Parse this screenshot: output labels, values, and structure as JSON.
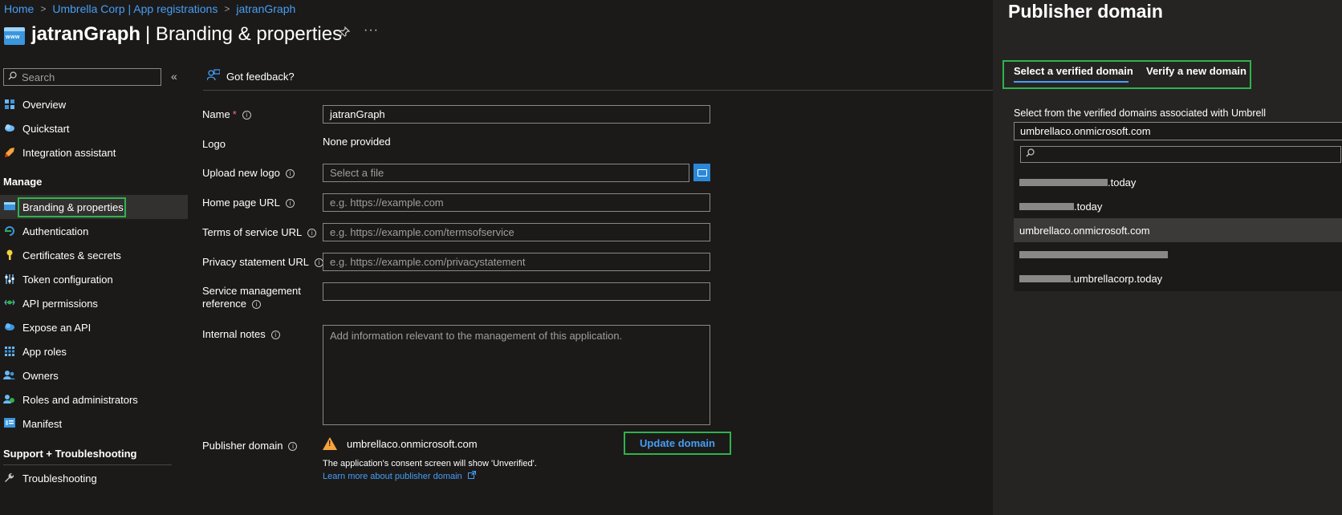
{
  "breadcrumb": {
    "items": [
      "Home",
      "Umbrella Corp | App registrations",
      "jatranGraph"
    ],
    "separator": ">"
  },
  "header": {
    "app_name": "jatranGraph",
    "page_suffix": "| Branding & properties",
    "more_label": "···"
  },
  "sidebar": {
    "search_placeholder": "Search",
    "collapse_label": "«",
    "items": [
      {
        "label": "Overview",
        "icon": "grid-icon",
        "color": "#6cb8f6"
      },
      {
        "label": "Quickstart",
        "icon": "cloud-icon",
        "color": "#6cb8f6"
      },
      {
        "label": "Integration assistant",
        "icon": "rocket-icon",
        "color": "#f7a33d"
      }
    ],
    "manage_heading": "Manage",
    "manage_items": [
      {
        "label": "Branding & properties",
        "icon": "www-icon",
        "color": "#3a96dd"
      },
      {
        "label": "Authentication",
        "icon": "auth-icon",
        "color": "#2fb34a"
      },
      {
        "label": "Certificates & secrets",
        "icon": "key-icon",
        "color": "#f7d23d"
      },
      {
        "label": "Token configuration",
        "icon": "sliders-icon",
        "color": "#6cb8f6"
      },
      {
        "label": "API permissions",
        "icon": "api-icon",
        "color": "#2fb34a"
      },
      {
        "label": "Expose an API",
        "icon": "cloud-icon",
        "color": "#6cb8f6"
      },
      {
        "label": "App roles",
        "icon": "grid-icon",
        "color": "#6cb8f6"
      },
      {
        "label": "Owners",
        "icon": "people-icon",
        "color": "#6cb8f6"
      },
      {
        "label": "Roles and administrators",
        "icon": "people-icon",
        "color": "#2fb34a"
      },
      {
        "label": "Manifest",
        "icon": "manifest-icon",
        "color": "#6cb8f6"
      }
    ],
    "support_heading": "Support + Troubleshooting",
    "support_items": [
      {
        "label": "Troubleshooting",
        "icon": "wrench-icon",
        "color": "#c8c6c4"
      }
    ]
  },
  "main": {
    "feedback_label": "Got feedback?",
    "fields": {
      "name_label": "Name",
      "name_required": "*",
      "name_value": "jatranGraph",
      "logo_label": "Logo",
      "logo_value": "None provided",
      "upload_label": "Upload new logo",
      "upload_placeholder": "Select a file",
      "homepage_label": "Home page URL",
      "homepage_placeholder": "e.g. https://example.com",
      "tos_label": "Terms of service URL",
      "tos_placeholder": "e.g. https://example.com/termsofservice",
      "privacy_label": "Privacy statement URL",
      "privacy_placeholder": "e.g. https://example.com/privacystatement",
      "svc_label_1": "Service management",
      "svc_label_2": "reference",
      "svc_value": "",
      "notes_label": "Internal notes",
      "notes_placeholder": "Add information relevant to the management of this application.",
      "publisher_label": "Publisher domain",
      "publisher_value": "umbrellaco.onmicrosoft.com",
      "update_button": "Update domain",
      "consent_text": "The application's consent screen will show 'Unverified'.",
      "learn_more": "Learn more about publisher domain"
    }
  },
  "panel": {
    "title": "Publisher domain",
    "tabs": [
      "Select a verified domain",
      "Verify a new domain"
    ],
    "description": "Select from the verified domains associated with Umbrell",
    "selected_value": "umbrellaco.onmicrosoft.com",
    "options": [
      {
        "suffix": ".today"
      },
      {
        "suffix": ".today"
      },
      {
        "text": "umbrellaco.onmicrosoft.com"
      },
      {
        "suffix": ""
      },
      {
        "suffix": ".umbrellacorp.today"
      }
    ]
  },
  "colors": {
    "accent": "#479ef5",
    "highlight": "#2fb34a",
    "warning": "#f7a33d",
    "background": "#1b1a19"
  }
}
